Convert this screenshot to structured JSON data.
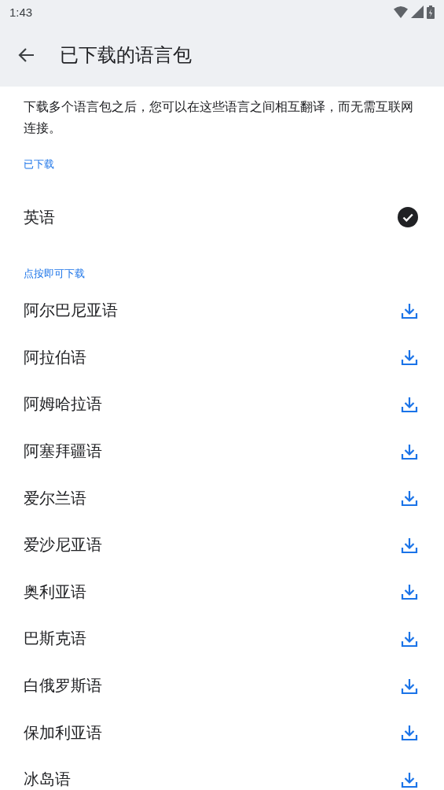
{
  "status_bar": {
    "time": "1:43"
  },
  "app_bar": {
    "title": "已下载的语言包"
  },
  "description": "下载多个语言包之后，您可以在这些语言之间相互翻译，而无需互联网连接。",
  "sections": [
    {
      "header": "已下载",
      "items": [
        {
          "name": "英语",
          "kind": "downloaded"
        }
      ]
    },
    {
      "header": "点按即可下载",
      "items": [
        {
          "name": "阿尔巴尼亚语",
          "kind": "download"
        },
        {
          "name": "阿拉伯语",
          "kind": "download"
        },
        {
          "name": "阿姆哈拉语",
          "kind": "download"
        },
        {
          "name": "阿塞拜疆语",
          "kind": "download"
        },
        {
          "name": "爱尔兰语",
          "kind": "download"
        },
        {
          "name": "爱沙尼亚语",
          "kind": "download"
        },
        {
          "name": "奥利亚语",
          "kind": "download"
        },
        {
          "name": "巴斯克语",
          "kind": "download"
        },
        {
          "name": "白俄罗斯语",
          "kind": "download"
        },
        {
          "name": "保加利亚语",
          "kind": "download"
        },
        {
          "name": "冰岛语",
          "kind": "download"
        }
      ]
    }
  ]
}
